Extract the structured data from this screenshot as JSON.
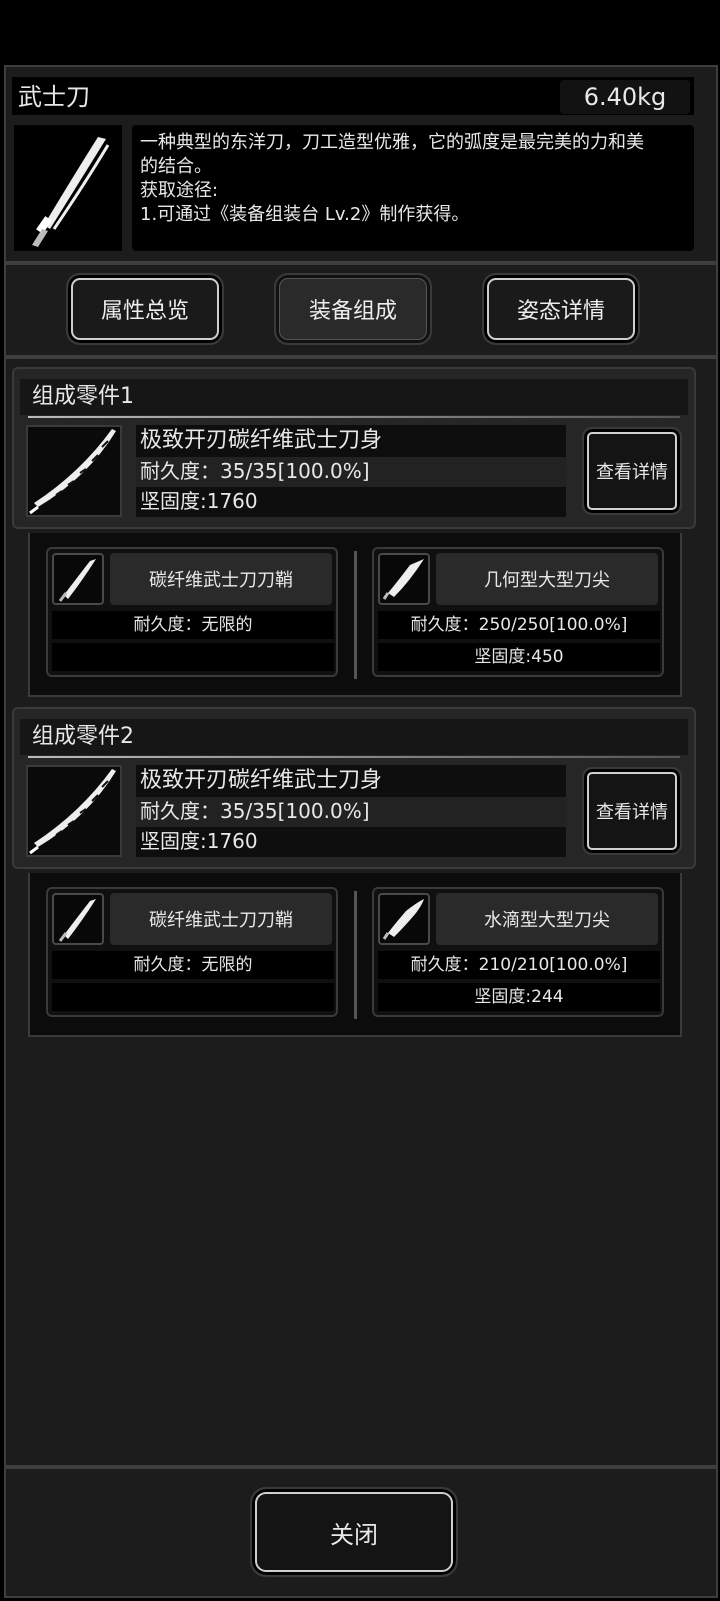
{
  "item": {
    "name": "武士刀",
    "weight": "6.40kg",
    "description_lines": [
      "一种典型的东洋刀，刀工造型优雅，它的弧度是最完美的力和美",
      "的结合。",
      "获取途径:",
      "1.可通过《装备组装台 Lv.2》制作获得。"
    ]
  },
  "tabs": [
    {
      "label": "属性总览",
      "style": "outlined"
    },
    {
      "label": "装备组成",
      "style": "selected"
    },
    {
      "label": "姿态详情",
      "style": "outlined"
    }
  ],
  "parts": [
    {
      "title": "组成零件1",
      "main": {
        "name": "极致开刃碳纤维武士刀身",
        "durability": "耐久度：35/35[100.0%]",
        "hardness": "坚固度:1760",
        "detail_button": "查看详情"
      },
      "subparts": [
        {
          "name": "碳纤维武士刀刀鞘",
          "durability": "耐久度：无限的",
          "hardness": ""
        },
        {
          "name": "几何型大型刀尖",
          "durability": "耐久度：250/250[100.0%]",
          "hardness": "坚固度:450"
        }
      ]
    },
    {
      "title": "组成零件2",
      "main": {
        "name": "极致开刃碳纤维武士刀身",
        "durability": "耐久度：35/35[100.0%]",
        "hardness": "坚固度:1760",
        "detail_button": "查看详情"
      },
      "subparts": [
        {
          "name": "碳纤维武士刀刀鞘",
          "durability": "耐久度：无限的",
          "hardness": ""
        },
        {
          "name": "水滴型大型刀尖",
          "durability": "耐久度：210/210[100.0%]",
          "hardness": "坚固度:244"
        }
      ]
    }
  ],
  "footer": {
    "close_label": "关闭"
  },
  "icons": {
    "item": "katana-icon",
    "blade": "blade-icon",
    "sheath": "sheath-icon",
    "tip": "blade-tip-icon"
  }
}
